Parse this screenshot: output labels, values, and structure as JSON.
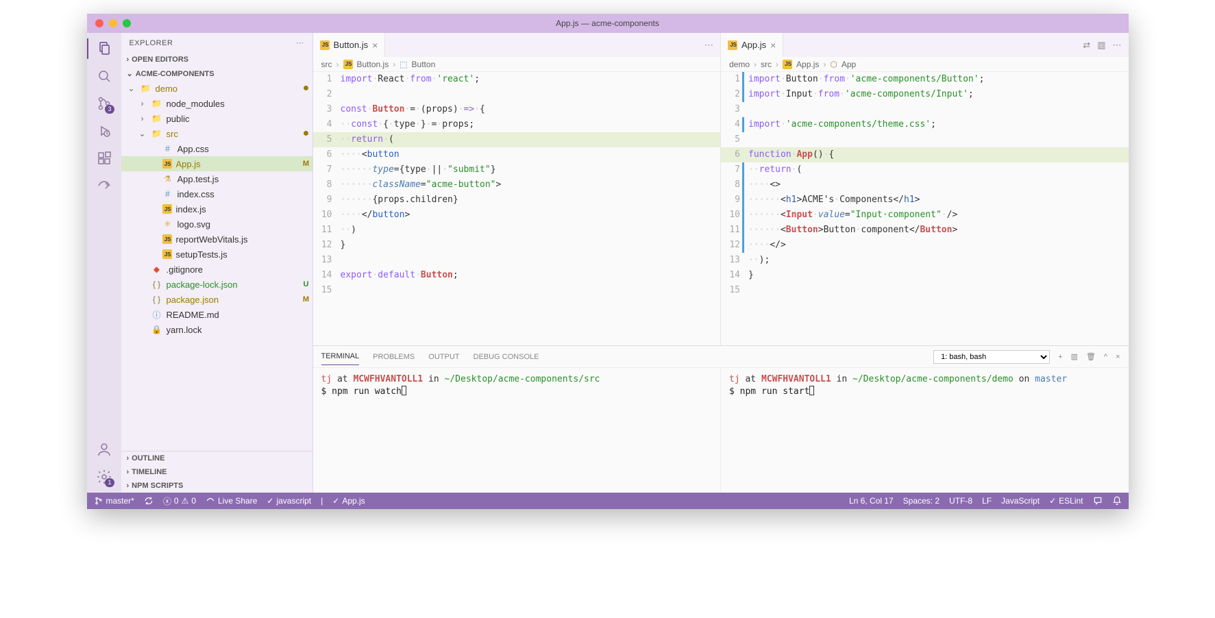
{
  "window": {
    "title": "App.js — acme-components"
  },
  "sidebar": {
    "title": "EXPLORER",
    "sections": {
      "openEditors": "OPEN EDITORS",
      "project": "ACME-COMPONENTS",
      "outline": "OUTLINE",
      "timeline": "TIMELINE",
      "npm": "NPM SCRIPTS"
    },
    "tree": [
      {
        "indent": 0,
        "chev": "v",
        "icon": "folder-g",
        "label": "demo",
        "status": "●",
        "cls": "folder-git"
      },
      {
        "indent": 1,
        "chev": ">",
        "icon": "folder",
        "label": "node_modules",
        "status": "",
        "cls": ""
      },
      {
        "indent": 1,
        "chev": ">",
        "icon": "folder",
        "label": "public",
        "status": "",
        "cls": ""
      },
      {
        "indent": 1,
        "chev": "v",
        "icon": "folder-g",
        "label": "src",
        "status": "●",
        "cls": "folder-git"
      },
      {
        "indent": 2,
        "chev": "",
        "icon": "css",
        "label": "App.css",
        "status": "",
        "cls": ""
      },
      {
        "indent": 2,
        "chev": "",
        "icon": "js",
        "label": "App.js",
        "status": "M",
        "cls": "modified selected"
      },
      {
        "indent": 2,
        "chev": "",
        "icon": "test",
        "label": "App.test.js",
        "status": "",
        "cls": ""
      },
      {
        "indent": 2,
        "chev": "",
        "icon": "css",
        "label": "index.css",
        "status": "",
        "cls": ""
      },
      {
        "indent": 2,
        "chev": "",
        "icon": "js",
        "label": "index.js",
        "status": "",
        "cls": ""
      },
      {
        "indent": 2,
        "chev": "",
        "icon": "svg",
        "label": "logo.svg",
        "status": "",
        "cls": ""
      },
      {
        "indent": 2,
        "chev": "",
        "icon": "js",
        "label": "reportWebVitals.js",
        "status": "",
        "cls": ""
      },
      {
        "indent": 2,
        "chev": "",
        "icon": "js",
        "label": "setupTests.js",
        "status": "",
        "cls": ""
      },
      {
        "indent": 1,
        "chev": "",
        "icon": "git",
        "label": ".gitignore",
        "status": "",
        "cls": ""
      },
      {
        "indent": 1,
        "chev": "",
        "icon": "json",
        "label": "package-lock.json",
        "status": "U",
        "cls": "untracked"
      },
      {
        "indent": 1,
        "chev": "",
        "icon": "json",
        "label": "package.json",
        "status": "M",
        "cls": "modified"
      },
      {
        "indent": 1,
        "chev": "",
        "icon": "md",
        "label": "README.md",
        "status": "",
        "cls": ""
      },
      {
        "indent": 1,
        "chev": "",
        "icon": "lock",
        "label": "yarn.lock",
        "status": "",
        "cls": ""
      }
    ]
  },
  "activity": {
    "scmBadge": "3",
    "settingsBadge": "1"
  },
  "editor1": {
    "tab": {
      "label": "Button.js"
    },
    "breadcrumb": [
      "src",
      "Button.js",
      "Button"
    ],
    "lines": [
      {
        "n": 1,
        "html": "<span class='kw'>import</span><span class='ws'>·</span><span class='id'>React</span><span class='ws'>·</span><span class='kw'>from</span><span class='ws'>·</span><span class='str'>'react'</span>;"
      },
      {
        "n": 2,
        "html": ""
      },
      {
        "n": 3,
        "html": "<span class='kw'>const</span><span class='ws'>·</span><span class='fn'>Button</span><span class='ws'>·</span>=<span class='ws'>·</span>(<span class='id'>props</span>)<span class='ws'>·</span><span class='kw'>=&gt;</span><span class='ws'>·</span>{"
      },
      {
        "n": 4,
        "html": "<span class='ws'>··</span><span class='kw'>const</span><span class='ws'>·</span>{<span class='ws'>·</span><span class='id'>type</span><span class='ws'>·</span>}<span class='ws'>·</span>=<span class='ws'>·</span><span class='id'>props</span>;"
      },
      {
        "n": 5,
        "hl": true,
        "html": "<span class='ws'>··</span><span class='kw'>return</span><span class='ws'>·</span>("
      },
      {
        "n": 6,
        "html": "<span class='ws'>····</span>&lt;<span class='tag'>button</span>"
      },
      {
        "n": 7,
        "html": "<span class='ws'>······</span><span class='attr'>type</span>={<span class='id'>type</span><span class='ws'>·</span>||<span class='ws'>·</span><span class='str'>\"submit\"</span>}"
      },
      {
        "n": 8,
        "html": "<span class='ws'>······</span><span class='attr'>className</span>=<span class='str'>\"acme-button\"</span>&gt;"
      },
      {
        "n": 9,
        "html": "<span class='ws'>······</span>{<span class='id'>props</span>.<span class='id'>children</span>}"
      },
      {
        "n": 10,
        "html": "<span class='ws'>····</span>&lt;/<span class='tag'>button</span>&gt;"
      },
      {
        "n": 11,
        "html": "<span class='ws'>··</span>)"
      },
      {
        "n": 12,
        "html": "}"
      },
      {
        "n": 13,
        "html": ""
      },
      {
        "n": 14,
        "html": "<span class='kw'>export</span><span class='ws'>·</span><span class='kw'>default</span><span class='ws'>·</span><span class='fn'>Button</span>;"
      },
      {
        "n": 15,
        "html": ""
      }
    ]
  },
  "editor2": {
    "tab": {
      "label": "App.js"
    },
    "breadcrumb": [
      "demo",
      "src",
      "App.js",
      "App"
    ],
    "lines": [
      {
        "n": 1,
        "mod": true,
        "html": "<span class='kw'>import</span><span class='ws'>·</span><span class='id'>Button</span><span class='ws'>·</span><span class='kw'>from</span><span class='ws'>·</span><span class='str'>'acme-components/Button'</span>;"
      },
      {
        "n": 2,
        "mod": true,
        "html": "<span class='kw'>import</span><span class='ws'>·</span><span class='id'>Input</span><span class='ws'>·</span><span class='kw'>from</span><span class='ws'>·</span><span class='str'>'acme-components/Input'</span>;"
      },
      {
        "n": 3,
        "html": ""
      },
      {
        "n": 4,
        "mod": true,
        "html": "<span class='kw'>import</span><span class='ws'>·</span><span class='str'>'acme-components/theme.css'</span>;"
      },
      {
        "n": 5,
        "html": ""
      },
      {
        "n": 6,
        "hl": true,
        "html": "<span class='kw'>function</span><span class='ws'>·</span><span class='fn'>App</span>()<span class='ws'>·</span>{"
      },
      {
        "n": 7,
        "mod": true,
        "html": "<span class='ws'>··</span><span class='kw'>return</span><span class='ws'>·</span>("
      },
      {
        "n": 8,
        "mod": true,
        "html": "<span class='ws'>····</span>&lt;&gt;"
      },
      {
        "n": 9,
        "mod": true,
        "html": "<span class='ws'>······</span>&lt;<span class='tag'>h1</span>&gt;ACME's<span class='ws'>·</span>Components&lt;/<span class='tag'>h1</span>&gt;"
      },
      {
        "n": 10,
        "mod": true,
        "html": "<span class='ws'>······</span>&lt;<span class='fn'>Input</span><span class='ws'>·</span><span class='attr'>value</span>=<span class='str'>\"Input·component\"</span><span class='ws'>·</span>/&gt;"
      },
      {
        "n": 11,
        "mod": true,
        "html": "<span class='ws'>······</span>&lt;<span class='fn'>Button</span>&gt;Button<span class='ws'>·</span>component&lt;/<span class='fn'>Button</span>&gt;"
      },
      {
        "n": 12,
        "mod": true,
        "html": "<span class='ws'>····</span>&lt;/&gt;"
      },
      {
        "n": 13,
        "html": "<span class='ws'>··</span>);"
      },
      {
        "n": 14,
        "html": "}"
      },
      {
        "n": 15,
        "html": ""
      }
    ]
  },
  "panel": {
    "tabs": {
      "terminal": "TERMINAL",
      "problems": "PROBLEMS",
      "output": "OUTPUT",
      "debug": "DEBUG CONSOLE"
    },
    "selector": "1: bash, bash",
    "term1": {
      "user": "tj",
      "at": "at",
      "host": "MCWFHVANTOLL1",
      "in": "in",
      "path": "~/Desktop/acme-components/src",
      "cmd": "$ npm run watch"
    },
    "term2": {
      "user": "tj",
      "at": "at",
      "host": "MCWFHVANTOLL1",
      "in": "in",
      "path": "~/Desktop/acme-components/demo",
      "on": "on",
      "branch": "master",
      "cmd": "$ npm run start"
    }
  },
  "status": {
    "branch": "master*",
    "errors": "0",
    "warnings": "0",
    "liveShare": "Live Share",
    "lang1": "javascript",
    "lang2": "App.js",
    "pos": "Ln 6, Col 17",
    "spaces": "Spaces: 2",
    "enc": "UTF-8",
    "eol": "LF",
    "mode": "JavaScript",
    "eslint": "ESLint"
  }
}
